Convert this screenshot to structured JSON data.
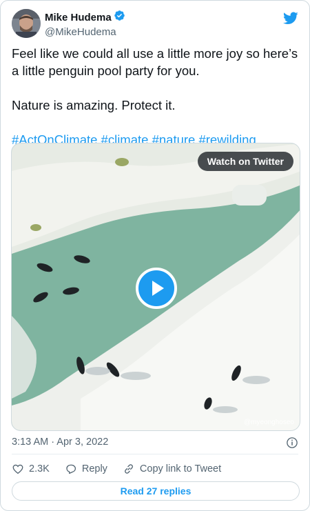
{
  "author": {
    "name": "Mike Hudema",
    "handle": "@MikeHudema"
  },
  "tweet": {
    "paragraphs": [
      "Feel like we could all use a little more joy so here’s a little penguin pool party for you.",
      "Nature is amazing. Protect it."
    ],
    "hashtags": "#ActOnClimate #climate #nature #rewilding"
  },
  "media": {
    "watch_label": "Watch on Twitter",
    "watermark": "@myeonghoseo"
  },
  "meta": {
    "timestamp": "3:13 AM · Apr 3, 2022"
  },
  "actions": {
    "likes": "2.3K",
    "reply_label": "Reply",
    "copy_label": "Copy link to Tweet"
  },
  "replies_button": "Read 27 replies",
  "colors": {
    "accent": "#1d9bf0",
    "text": "#0f1419",
    "muted": "#536471",
    "border": "#cfd9de"
  },
  "icons": [
    "verified-badge-icon",
    "twitter-bird-icon",
    "play-icon",
    "info-icon",
    "heart-icon",
    "reply-icon",
    "link-icon"
  ]
}
